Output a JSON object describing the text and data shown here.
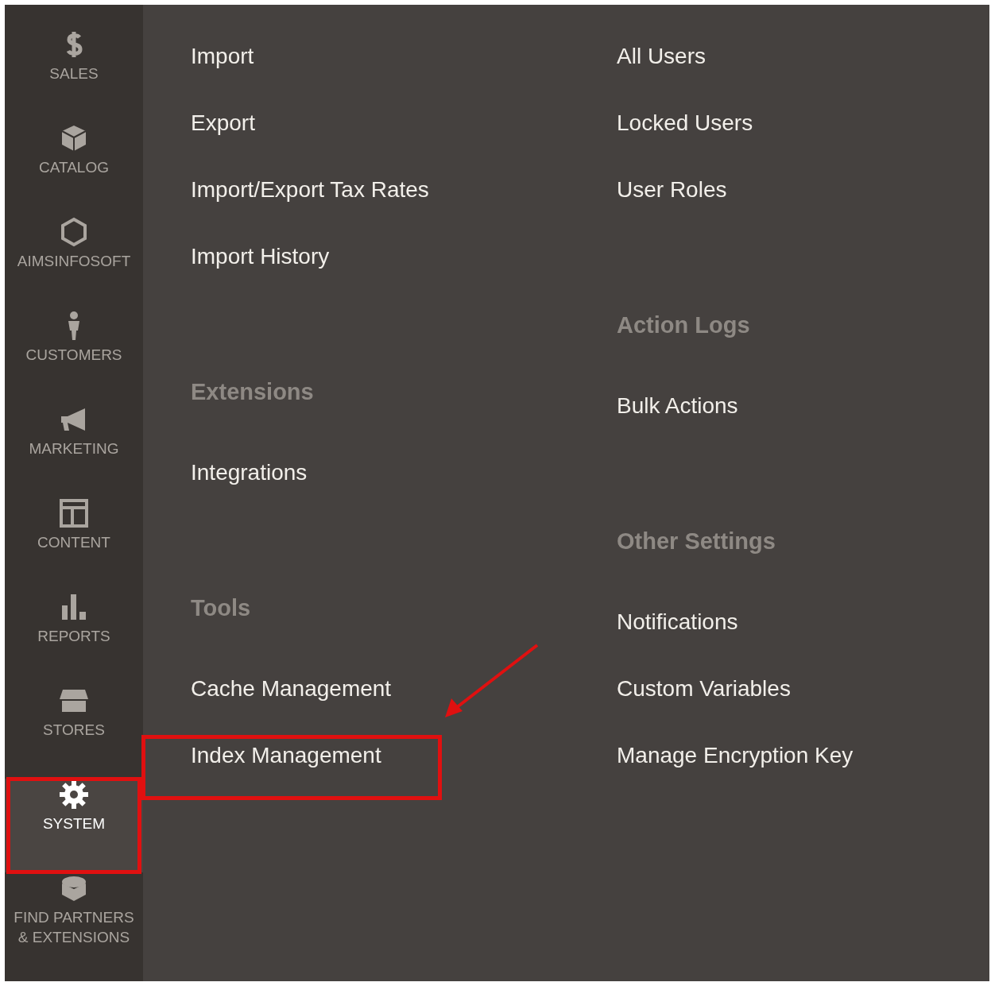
{
  "sidebar": {
    "items": [
      {
        "label": "SALES",
        "selected": false,
        "highlighted": false
      },
      {
        "label": "CATALOG",
        "selected": false,
        "highlighted": false
      },
      {
        "label": "AIMSINFOSOFT",
        "selected": false,
        "highlighted": false
      },
      {
        "label": "CUSTOMERS",
        "selected": false,
        "highlighted": false
      },
      {
        "label": "MARKETING",
        "selected": false,
        "highlighted": false
      },
      {
        "label": "CONTENT",
        "selected": false,
        "highlighted": false
      },
      {
        "label": "REPORTS",
        "selected": false,
        "highlighted": false
      },
      {
        "label": "STORES",
        "selected": false,
        "highlighted": false
      },
      {
        "label": "SYSTEM",
        "selected": true,
        "highlighted": true
      },
      {
        "label": "FIND PARTNERS & EXTENSIONS",
        "selected": false,
        "highlighted": false
      }
    ]
  },
  "menu": {
    "columns": [
      {
        "sections": [
          {
            "items": [
              {
                "label": "Import",
                "highlighted": false
              },
              {
                "label": "Export",
                "highlighted": false
              },
              {
                "label": "Import/Export Tax Rates",
                "highlighted": false
              },
              {
                "label": "Import History",
                "highlighted": false
              }
            ]
          },
          {
            "heading": "Extensions",
            "items": [
              {
                "label": "Integrations",
                "highlighted": false
              }
            ]
          },
          {
            "heading": "Tools",
            "items": [
              {
                "label": "Cache Management",
                "highlighted": false
              },
              {
                "label": "Index Management",
                "highlighted": true
              }
            ]
          }
        ]
      },
      {
        "sections": [
          {
            "items": [
              {
                "label": "All Users",
                "highlighted": false
              },
              {
                "label": "Locked Users",
                "highlighted": false
              },
              {
                "label": "User Roles",
                "highlighted": false
              }
            ]
          },
          {
            "heading": "Action Logs",
            "items": [
              {
                "label": "Bulk Actions",
                "highlighted": false
              }
            ]
          },
          {
            "heading": "Other Settings",
            "items": [
              {
                "label": "Notifications",
                "highlighted": false
              },
              {
                "label": "Custom Variables",
                "highlighted": false
              },
              {
                "label": "Manage Encryption Key",
                "highlighted": false
              }
            ]
          }
        ]
      }
    ]
  }
}
